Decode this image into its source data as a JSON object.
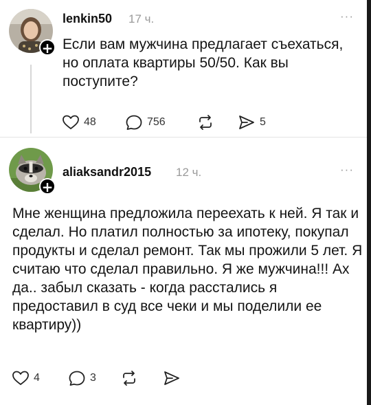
{
  "posts": [
    {
      "username": "lenkin50",
      "time": "17 ч.",
      "more": "···",
      "text": "Если вам мужчина предлагает съехаться, но оплата квартиры 50/50. Как вы поступите?",
      "likes": "48",
      "replies": "756",
      "shares": "5"
    },
    {
      "username": "aliaksandr2015",
      "time": "12 ч.",
      "more": "···",
      "text": "Мне женщина предложила переехать к ней. Я так и сделал. Но платил полностью за ипотеку, покупал продукты и сделал ремонт. Так мы прожили 5 лет. Я считаю что сделал правильно. Я же мужчина!!! Ах да.. забыл сказать - когда расстались я предоставил в суд все чеки и мы поделили ее квартиру))",
      "likes": "4",
      "replies": "3"
    }
  ],
  "icons": {
    "like": "heart-icon",
    "reply": "comment-bubble-icon",
    "repost": "repost-arrows-icon",
    "share": "send-icon",
    "follow": "plus-icon"
  },
  "colors": {
    "text": "#141414",
    "muted": "#9a9a9a",
    "thread_line": "#d7d7d7",
    "badge": "#000000"
  }
}
